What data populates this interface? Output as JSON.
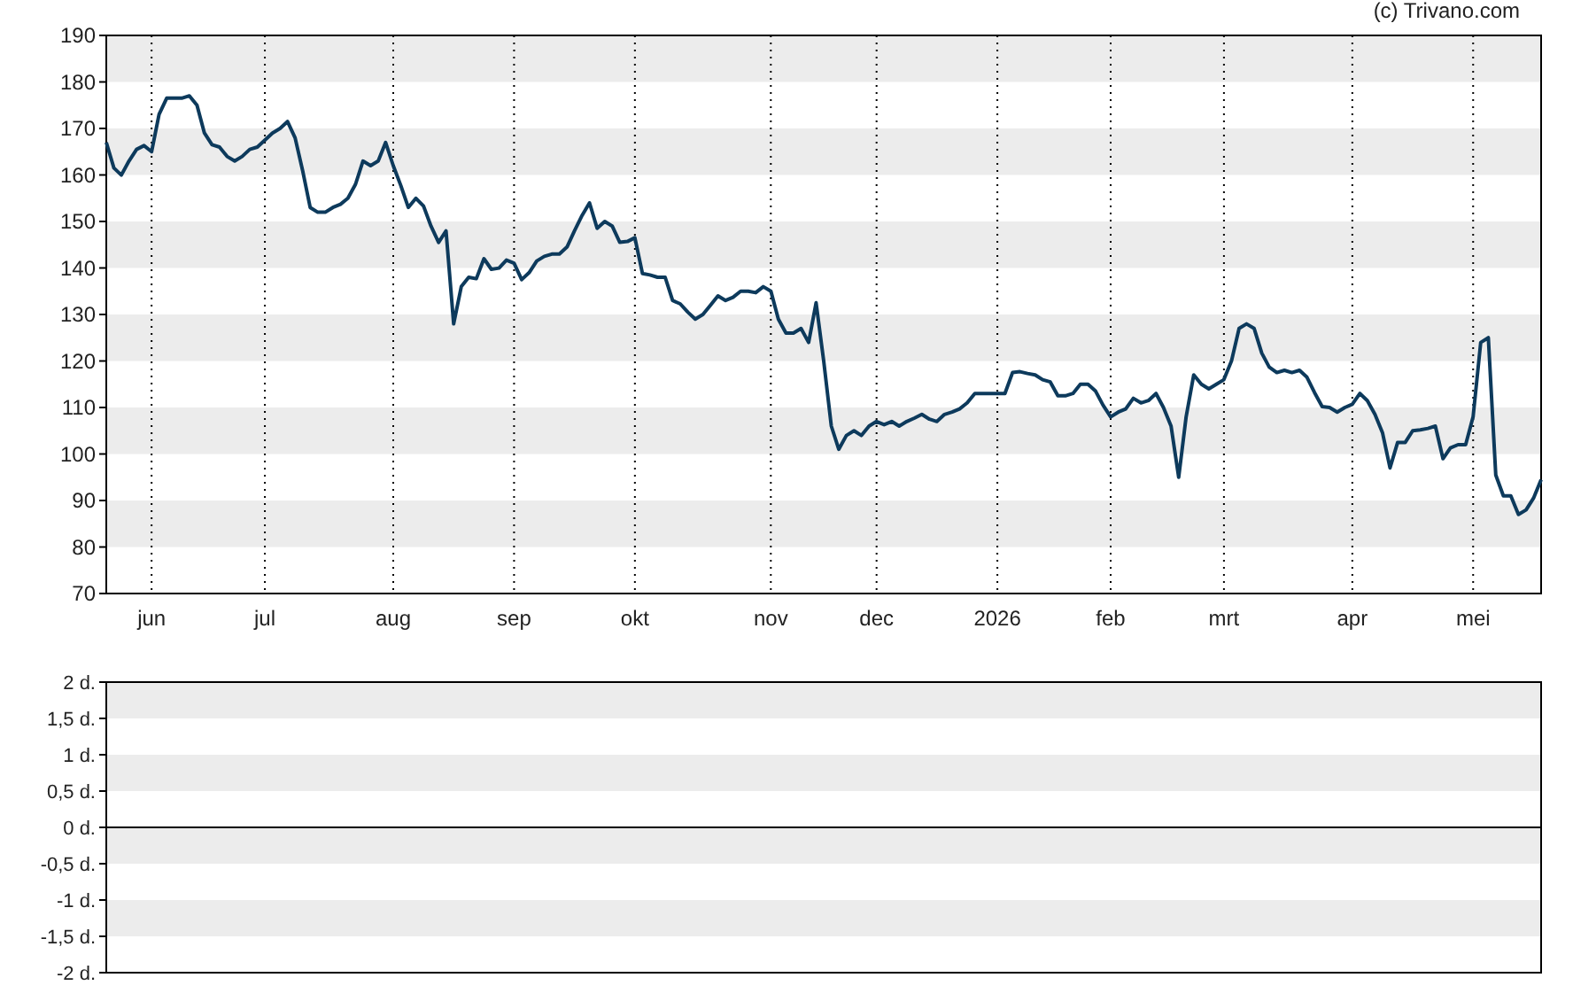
{
  "copyright": "(c) Trivano.com",
  "price_chart": {
    "chart_data": {
      "type": "line",
      "ylim": [
        70,
        190
      ],
      "yticks": [
        70,
        80,
        90,
        100,
        110,
        120,
        130,
        140,
        150,
        160,
        170,
        180,
        190
      ],
      "categories": [
        null,
        null,
        null,
        null,
        null,
        null,
        "jun",
        null,
        null,
        null,
        null,
        null,
        null,
        null,
        null,
        null,
        null,
        null,
        null,
        null,
        null,
        "jul",
        null,
        null,
        null,
        null,
        null,
        null,
        null,
        null,
        null,
        null,
        null,
        null,
        null,
        null,
        null,
        null,
        "aug",
        null,
        null,
        null,
        null,
        null,
        null,
        null,
        null,
        null,
        null,
        null,
        null,
        null,
        null,
        null,
        "sep",
        null,
        null,
        null,
        null,
        null,
        null,
        null,
        null,
        null,
        null,
        null,
        null,
        null,
        null,
        null,
        "okt",
        null,
        null,
        null,
        null,
        null,
        null,
        null,
        null,
        null,
        null,
        null,
        null,
        null,
        null,
        null,
        null,
        null,
        "nov",
        null,
        null,
        null,
        null,
        null,
        null,
        null,
        null,
        null,
        null,
        null,
        null,
        null,
        "dec",
        null,
        null,
        null,
        null,
        null,
        null,
        null,
        null,
        null,
        null,
        null,
        null,
        null,
        null,
        null,
        "2026",
        null,
        null,
        null,
        null,
        null,
        null,
        null,
        null,
        null,
        null,
        null,
        null,
        null,
        null,
        "feb",
        null,
        null,
        null,
        null,
        null,
        null,
        null,
        null,
        null,
        null,
        null,
        null,
        null,
        null,
        "mrt",
        null,
        null,
        null,
        null,
        null,
        null,
        null,
        null,
        null,
        null,
        null,
        null,
        null,
        null,
        null,
        null,
        "apr",
        null,
        null,
        null,
        null,
        null,
        null,
        null,
        null,
        null,
        null,
        null,
        null,
        null,
        null,
        null,
        "mei",
        null,
        null,
        null,
        null,
        null,
        null,
        null,
        null,
        null
      ],
      "series": [
        {
          "color": "#0d3a5c",
          "values": [
            167,
            161.5,
            160,
            163,
            165.5,
            166.3,
            165,
            173,
            176.5,
            176.5,
            176.5,
            177,
            175,
            169,
            166.5,
            166,
            164,
            163,
            164,
            165.5,
            166,
            167.5,
            169,
            170,
            171.5,
            168,
            161,
            153,
            152,
            152,
            153,
            153.7,
            155,
            158,
            163,
            162,
            163,
            167,
            162,
            157.7,
            153,
            155,
            153.3,
            149,
            145.5,
            148,
            128,
            136,
            138,
            137.7,
            142,
            139.7,
            140,
            141.7,
            141,
            137.5,
            139,
            141.5,
            142.5,
            143,
            143,
            144.5,
            148,
            151.3,
            154,
            148.5,
            150,
            149,
            145.5,
            145.7,
            146.5,
            138.8,
            138.5,
            138,
            138,
            133,
            132.3,
            130.5,
            129,
            130,
            132,
            134,
            133,
            133.7,
            135,
            135,
            134.7,
            136,
            135,
            129,
            126,
            126,
            127,
            124,
            132.5,
            120,
            106,
            101,
            104,
            105,
            104,
            106,
            107,
            106.3,
            107,
            106,
            107,
            107.7,
            108.5,
            107.5,
            107,
            108.5,
            109,
            109.7,
            111,
            113,
            113,
            113,
            113,
            113,
            117.5,
            117.7,
            117.3,
            117,
            116,
            115.5,
            112.5,
            112.5,
            113,
            115,
            115,
            113.5,
            110.5,
            108,
            109,
            109.7,
            112,
            111,
            111.5,
            113,
            110,
            106,
            95,
            108,
            117,
            115,
            114,
            115,
            116,
            120,
            127,
            128,
            127,
            121.7,
            118.7,
            117.5,
            118,
            117.5,
            118,
            116.5,
            113.2,
            110.2,
            110,
            109,
            110,
            110.7,
            113,
            111.5,
            108.5,
            104.5,
            97,
            102.5,
            102.5,
            105,
            105.2,
            105.5,
            106,
            99,
            101.3,
            102,
            102,
            108,
            124,
            125,
            95.5,
            91,
            91,
            87,
            88,
            90.5,
            94.5
          ]
        }
      ]
    }
  },
  "days_panel": {
    "y_labels": [
      "2 d.",
      "1,5 d.",
      "1 d.",
      "0,5 d.",
      "0 d.",
      "-0,5 d.",
      "-1 d.",
      "-1,5 d.",
      "-2 d."
    ]
  }
}
